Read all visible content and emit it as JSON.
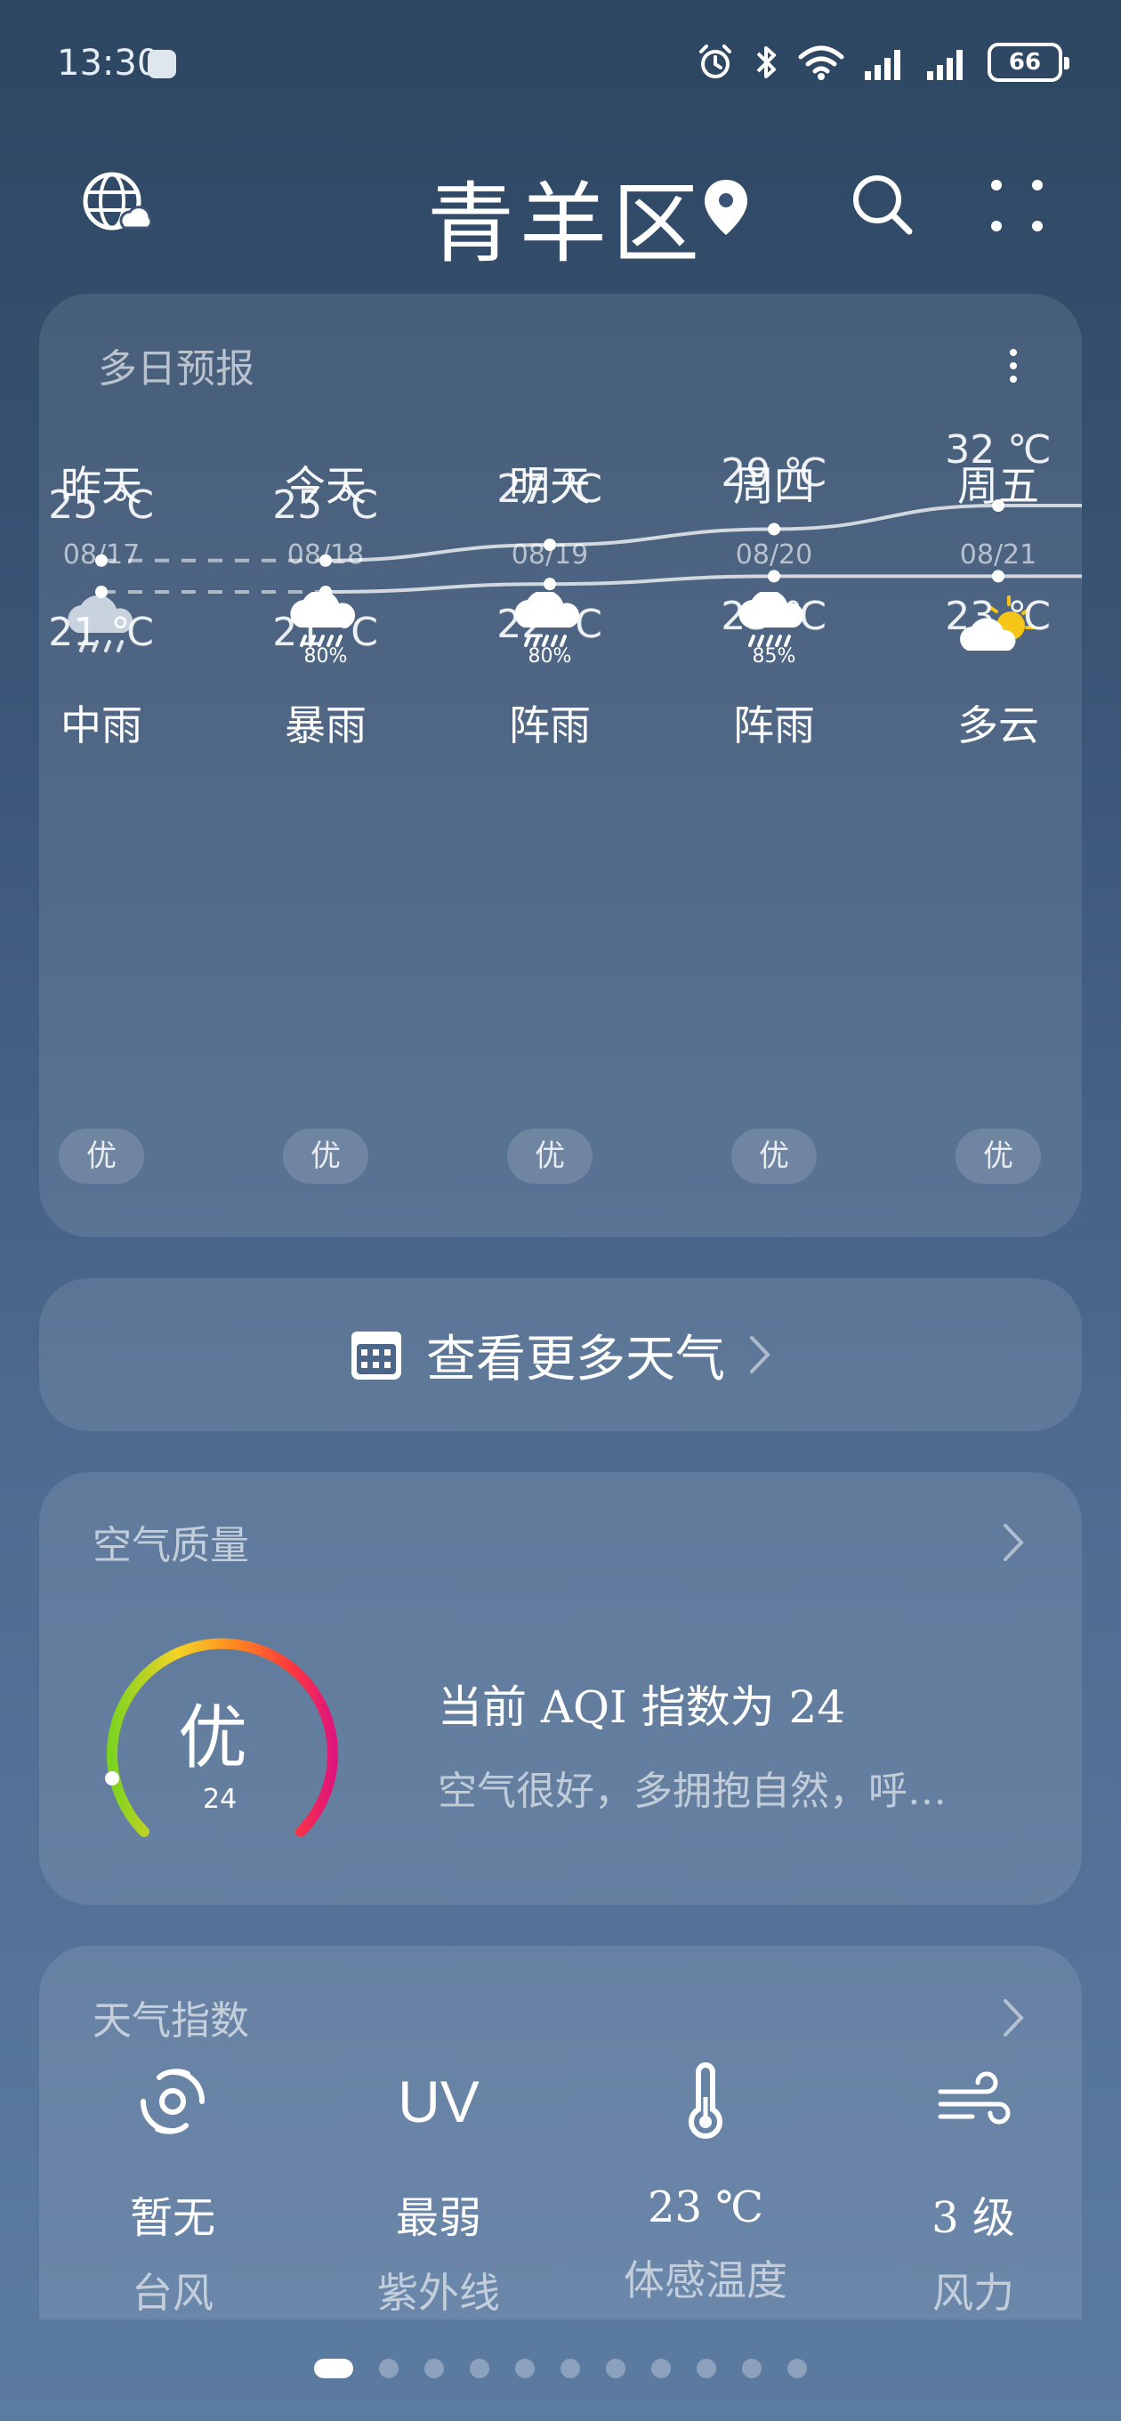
{
  "status_bar": {
    "time": "13:30",
    "battery": "66"
  },
  "header": {
    "title": "青羊区"
  },
  "forecast": {
    "title": "多日预报",
    "days": [
      {
        "name": "昨天",
        "date": "08/17",
        "icon": "cloud-rain-icon",
        "precip": "",
        "condition": "中雨",
        "high": "25 ℃",
        "low": "21 ℃",
        "aqi": "优"
      },
      {
        "name": "今天",
        "date": "08/18",
        "icon": "cloud-heavy-rain-icon",
        "precip": "80%",
        "condition": "暴雨",
        "high": "25 ℃",
        "low": "21 ℃",
        "aqi": "优"
      },
      {
        "name": "明天",
        "date": "08/19",
        "icon": "cloud-heavy-rain-icon",
        "precip": "80%",
        "condition": "阵雨",
        "high": "27 ℃",
        "low": "22 ℃",
        "aqi": "优"
      },
      {
        "name": "周四",
        "date": "08/20",
        "icon": "cloud-heavy-rain-icon",
        "precip": "85%",
        "condition": "阵雨",
        "high": "29 ℃",
        "low": "23 ℃",
        "aqi": "优"
      },
      {
        "name": "周五",
        "date": "08/21",
        "icon": "partly-cloudy-icon",
        "precip": "",
        "condition": "多云",
        "high": "32 ℃",
        "low": "23 ℃",
        "aqi": "优"
      }
    ]
  },
  "chart_data": {
    "type": "line",
    "categories": [
      "08/17",
      "08/18",
      "08/19",
      "08/20",
      "08/21"
    ],
    "series": [
      {
        "values": [
          25,
          25,
          27,
          29,
          32
        ]
      },
      {
        "values": [
          21,
          21,
          22,
          23,
          23
        ]
      }
    ],
    "ylim": [
      20,
      33
    ]
  },
  "more_weather": {
    "label": "查看更多天气"
  },
  "air_quality": {
    "title": "空气质量",
    "grade": "优",
    "aqi": "24",
    "headline": "当前 AQI 指数为 24",
    "description": "空气很好，多拥抱自然，呼…"
  },
  "indices": {
    "title": "天气指数",
    "items": [
      {
        "icon": "typhoon-icon",
        "value": "暂无",
        "label": "台风"
      },
      {
        "icon": "uv-icon",
        "value": "最弱",
        "label": "紫外线",
        "glyph": "UV"
      },
      {
        "icon": "thermometer-icon",
        "value": "23 ℃",
        "label": "体感温度"
      },
      {
        "icon": "wind-icon",
        "value": "3 级",
        "label": "风力"
      }
    ]
  },
  "pager": {
    "count": 11,
    "active": 0
  },
  "colors": {
    "accent": "#ffffff",
    "aqi_ring_start": "#7ed321",
    "aqi_ring_end": "#e0157a"
  }
}
